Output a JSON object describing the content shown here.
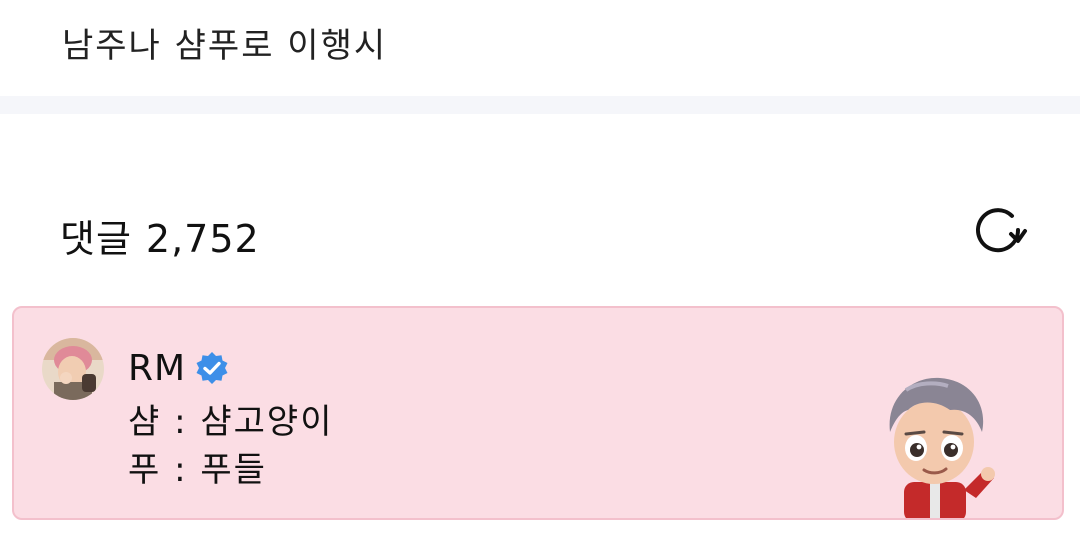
{
  "post": {
    "title": "남주나 샴푸로 이행시"
  },
  "comments": {
    "label": "댓글",
    "count": "2,752"
  },
  "icons": {
    "refresh": "refresh-icon",
    "verified": "verified-badge-icon"
  },
  "pinned_comment": {
    "author": "RM",
    "verified": true,
    "lines": [
      "샴 : 샴고양이",
      "푸 : 푸들"
    ]
  },
  "colors": {
    "card_background": "#fbdde4",
    "card_border": "#f3c0cc",
    "verified_blue": "#3d8fe8",
    "divider": "#f5f6fa"
  }
}
